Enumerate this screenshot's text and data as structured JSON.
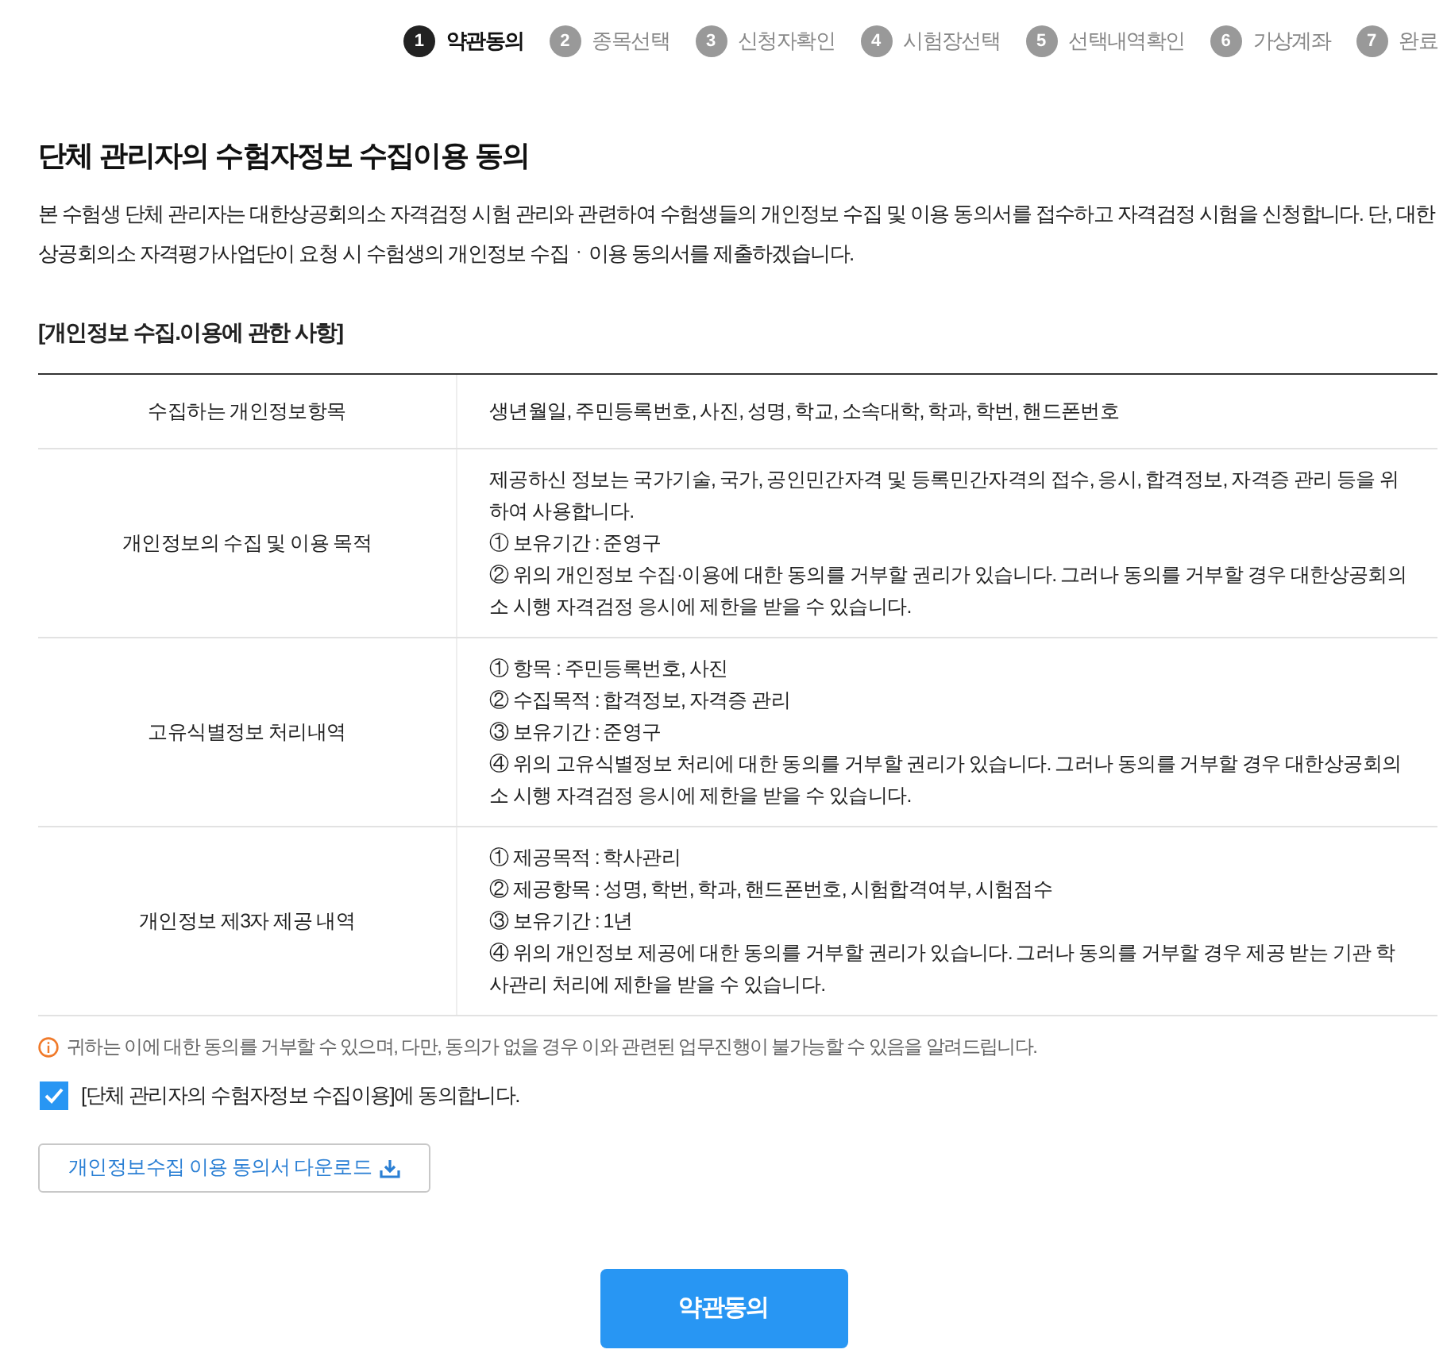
{
  "steps": [
    {
      "number": "1",
      "label": "약관동의",
      "selected": true
    },
    {
      "number": "2",
      "label": "종목선택",
      "selected": false
    },
    {
      "number": "3",
      "label": "신청자확인",
      "selected": false
    },
    {
      "number": "4",
      "label": "시험장선택",
      "selected": false
    },
    {
      "number": "5",
      "label": "선택내역확인",
      "selected": false
    },
    {
      "number": "6",
      "label": "가상계좌",
      "selected": false
    },
    {
      "number": "7",
      "label": "완료",
      "selected": false
    }
  ],
  "title": "단체 관리자의 수험자정보 수집이용 동의",
  "intro": "본 수험생 단체 관리자는 대한상공회의소 자격검정 시험 관리와 관련하여 수험생들의 개인정보 수집 및 이용 동의서를 접수하고 자격검정 시험을 신청합니다. 단, 대한상공회의소 자격평가사업단이 요청 시 수험생의 개인정보 수집ㆍ이용 동의서를 제출하겠습니다.",
  "section_heading": "[개인정보 수집.이용에 관한 사항]",
  "table": {
    "rows": [
      {
        "header": "수집하는 개인정보항목",
        "lines": [
          "생년월일, 주민등록번호, 사진, 성명, 학교, 소속대학, 학과, 학번, 핸드폰번호"
        ]
      },
      {
        "header": "개인정보의 수집 및 이용 목적",
        "lines": [
          "제공하신 정보는 국가기술, 국가, 공인민간자격 및 등록민간자격의 접수, 응시, 합격정보, 자격증 관리 등을 위하여 사용합니다.",
          "① 보유기간 : 준영구",
          "② 위의 개인정보 수집·이용에 대한 동의를 거부할 권리가 있습니다. 그러나 동의를 거부할 경우 대한상공회의소 시행 자격검정 응시에 제한을 받을 수 있습니다."
        ]
      },
      {
        "header": "고유식별정보 처리내역",
        "lines": [
          "① 항목 : 주민등록번호, 사진",
          "② 수집목적 : 합격정보, 자격증 관리",
          "③ 보유기간 : 준영구",
          "④ 위의 고유식별정보 처리에 대한 동의를 거부할 권리가 있습니다. 그러나 동의를 거부할 경우 대한상공회의소 시행 자격검정 응시에 제한을 받을 수 있습니다."
        ]
      },
      {
        "header": "개인정보 제3자 제공 내역",
        "lines": [
          "① 제공목적 : 학사관리",
          "② 제공항목 : 성명, 학번, 학과, 핸드폰번호, 시험합격여부, 시험점수",
          "③ 보유기간 : 1년",
          "④ 위의 개인정보 제공에 대한 동의를 거부할 권리가 있습니다. 그러나 동의를 거부할 경우 제공 받는 기관 학사관리 처리에 제한을 받을 수 있습니다."
        ]
      }
    ]
  },
  "notice": "귀하는 이에 대한 동의를 거부할 수 있으며, 다만, 동의가 없을 경우 이와 관련된 업무진행이 불가능할 수 있음을 알려드립니다.",
  "agreement": {
    "label": "[단체 관리자의 수험자정보 수집이용]에 동의합니다.",
    "checked": true
  },
  "download_button": {
    "label": "개인정보수집 이용 동의서 다운로드"
  },
  "submit_button": {
    "label": "약관동의"
  }
}
